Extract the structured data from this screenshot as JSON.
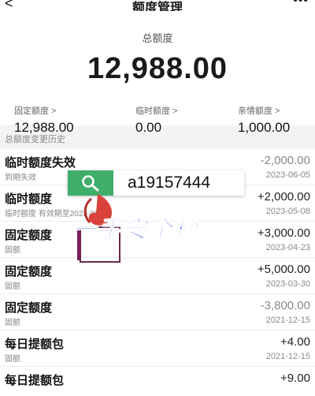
{
  "nav": {
    "back": "<",
    "title": "额度管理",
    "more": "•••"
  },
  "summary": {
    "total_label": "总额度",
    "total_value": "12,988.00",
    "items": [
      {
        "label": "固定额度 >",
        "value": "12,988.00"
      },
      {
        "label": "临时额度 >",
        "value": "0.00"
      },
      {
        "label": "亲情额度 >",
        "value": "1,000.00"
      }
    ]
  },
  "history_title": "总额度变更历史",
  "history": [
    {
      "name": "临时额度失效",
      "note": "到期失效",
      "amount": "-2,000.00",
      "date": "2023-06-05"
    },
    {
      "name": "临时额度",
      "note": "临时额度 有效期至2023-06-05",
      "amount": "+2,000.00",
      "date": "2023-05-08"
    },
    {
      "name": "固定额度",
      "note": "固额",
      "amount": "+3,000.00",
      "date": "2023-04-23"
    },
    {
      "name": "固定额度",
      "note": "固额",
      "amount": "+5,000.00",
      "date": "2023-03-30"
    },
    {
      "name": "固定额度",
      "note": "固额",
      "amount": "-3,800.00",
      "date": "2021-12-15"
    },
    {
      "name": "每日提额包",
      "note": "固额",
      "amount": "+4.00",
      "date": "2021-12-15"
    },
    {
      "name": "每日提额包",
      "note": "",
      "amount": "+9.00",
      "date": ""
    }
  ],
  "watermark": {
    "id_text": "a19157444",
    "banner": "一手安全秒"
  },
  "colors": {
    "watermark_green": "#3fae6a",
    "banner_blue": "#1c3fe0"
  }
}
